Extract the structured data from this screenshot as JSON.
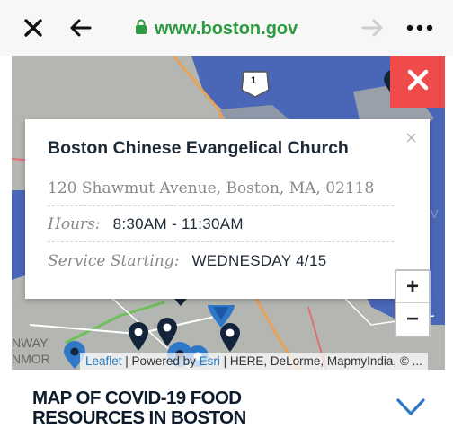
{
  "browser": {
    "url": "www.boston.gov",
    "icons": [
      "close-icon",
      "back-arrow-icon",
      "lock-icon",
      "forward-arrow-icon",
      "more-icon"
    ]
  },
  "map": {
    "route_shield": "1",
    "edge_text_right": "Riv",
    "edge_text_left_1": "NWAY",
    "edge_text_left_2": "NMOR",
    "popup": {
      "title": "Boston Chinese Evangelical Church",
      "close_symbol": "×",
      "address": "120 Shawmut Avenue, Boston, MA, 02118",
      "hours_label": "Hours:",
      "hours_value": "8:30AM - 11:30AM",
      "service_label": "Service Starting:",
      "service_value": "WEDNESDAY 4/15"
    },
    "zoom_in": "+",
    "zoom_out": "−",
    "attribution": {
      "leaflet": "Leaflet",
      "sep1": " | Powered by ",
      "esri": "Esri",
      "rest": " | HERE, DeLorme, MapmyIndia, © ..."
    },
    "colors": {
      "water": "#4a66b7",
      "close": "#ef4b4b",
      "pin": "#13243a",
      "pin_selected": "#2f78c8"
    }
  },
  "footer": {
    "title_line1": "MAP OF COVID-19 FOOD",
    "title_line2": "RESOURCES IN BOSTON"
  }
}
